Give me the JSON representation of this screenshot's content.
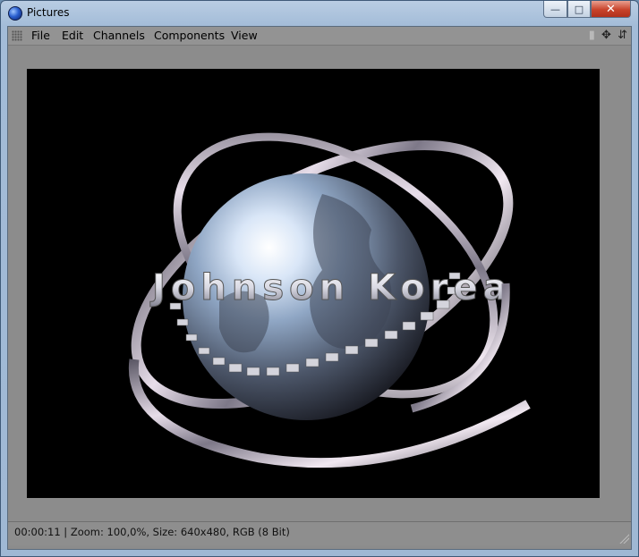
{
  "window": {
    "title": "Pictures",
    "controls": {
      "minimize": "—",
      "maximize": "□",
      "close": "✕"
    }
  },
  "menu": {
    "items": [
      "File",
      "Edit",
      "Channels",
      "Components",
      "View"
    ]
  },
  "toolbar_icons": [
    "pan-icon",
    "move-icon",
    "scroll-icon"
  ],
  "render": {
    "caption": "Johnson Korea",
    "background": "#000000"
  },
  "status": {
    "text": "00:00:11 | Zoom: 100,0%, Size: 640x480, RGB (8 Bit)"
  },
  "colors": {
    "client_bg": "#8c8c8c",
    "menu_bg": "#939393",
    "viewport_bg": "#000000",
    "title_gradient": "#b9cde3"
  }
}
